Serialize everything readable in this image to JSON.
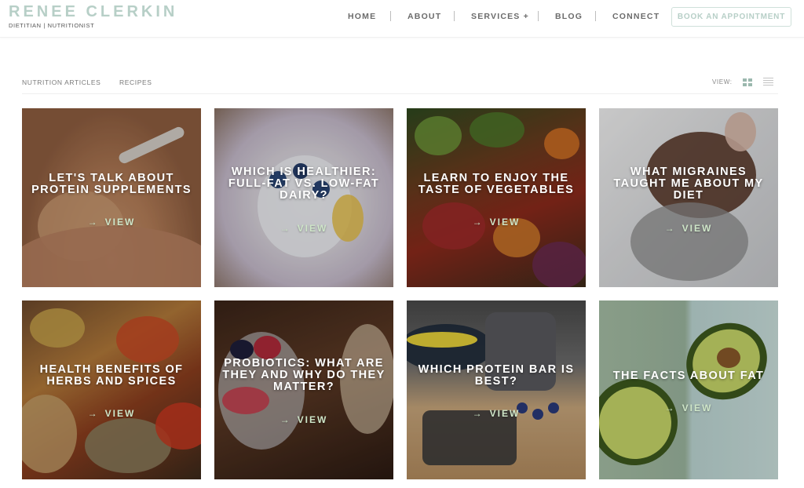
{
  "brand": {
    "name": "RENEE CLERKIN",
    "tagline": "DIETITIAN | NUTRITIONIST",
    "color": "#b7cfc7"
  },
  "nav": {
    "items": [
      "HOME",
      "ABOUT",
      "SERVICES +",
      "BLOG",
      "CONNECT"
    ],
    "cta": "BOOK AN APPOINTMENT"
  },
  "filters": {
    "items": [
      "NUTRITION ARTICLES",
      "RECIPES"
    ],
    "view_label": "VIEW:",
    "active_view": "grid-icon",
    "inactive_view": "list-icon"
  },
  "cards": [
    {
      "title_lines": [
        "LET'S TALK ABOUT",
        "PROTEIN SUPPLEMENTS"
      ],
      "view": "VIEW"
    },
    {
      "title_lines": [
        "WHICH IS HEALTHIER:",
        "FULL-FAT VS. LOW-FAT",
        "DAIRY?"
      ],
      "view": "VIEW"
    },
    {
      "title_lines": [
        "LEARN TO ENJOY THE",
        "TASTE OF VEGETABLES"
      ],
      "view": "VIEW"
    },
    {
      "title_lines": [
        "WHAT MIGRAINES",
        "TAUGHT ME ABOUT MY",
        "DIET"
      ],
      "view": "VIEW"
    },
    {
      "title_lines": [
        "HEALTH BENEFITS OF",
        "HERBS AND SPICES"
      ],
      "view": "VIEW"
    },
    {
      "title_lines": [
        "PROBIOTICS: WHAT ARE",
        "THEY AND WHY DO THEY",
        "MATTER?"
      ],
      "view": "VIEW"
    },
    {
      "title_lines": [
        "WHICH PROTEIN BAR IS",
        "BEST?"
      ],
      "view": "VIEW"
    },
    {
      "title_lines": [
        "THE FACTS ABOUT FAT"
      ],
      "view": "VIEW"
    }
  ],
  "colors": {
    "view_text": "#cfe6c9",
    "accent": "#9bb8ae"
  }
}
